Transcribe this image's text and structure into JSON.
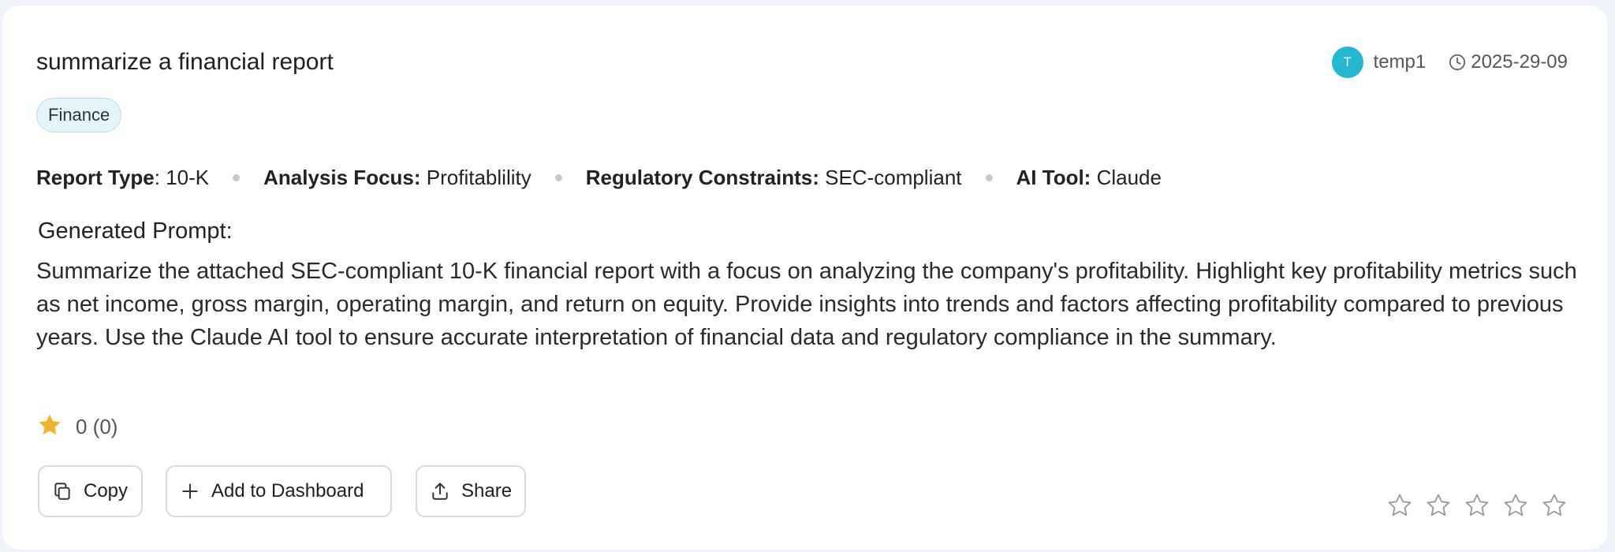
{
  "card": {
    "title": "summarize a financial report",
    "user": {
      "avatar_letter": "T",
      "name": "temp1"
    },
    "date": "2025-29-09",
    "tag": "Finance",
    "params": [
      {
        "key": "Report Type",
        "sep": ": ",
        "value": "10-K"
      },
      {
        "key": "Analysis Focus:",
        "sep": " ",
        "value": "Profitablility"
      },
      {
        "key": "Regulatory Constraints:",
        "sep": " ",
        "value": "SEC-compliant"
      },
      {
        "key": "AI Tool:",
        "sep": " ",
        "value": "Claude"
      }
    ],
    "generated_label": "Generated Prompt:",
    "prompt_text": "Summarize the attached SEC-compliant 10-K financial report with a focus on analyzing the company's profitability. Highlight key profitability metrics such as net income, gross margin, operating margin, and return on equity. Provide insights into trends and factors affecting profitability compared to previous years. Use the Claude AI tool to ensure accurate interpretation of financial data and regulatory compliance in the summary.",
    "rating": {
      "text": "0 (0)",
      "value": 0,
      "count": 0
    },
    "buttons": {
      "copy": "Copy",
      "add": "Add to Dashboard",
      "share": "Share"
    },
    "user_rating": {
      "filled": 0,
      "max": 5
    }
  },
  "colors": {
    "avatar": "#22b8cf",
    "star_filled": "#f0b429",
    "tag_bg": "#e3f5f8"
  },
  "icons": [
    "clock-icon",
    "star-icon",
    "copy-icon",
    "plus-icon",
    "share-icon",
    "star-outline-icon"
  ]
}
